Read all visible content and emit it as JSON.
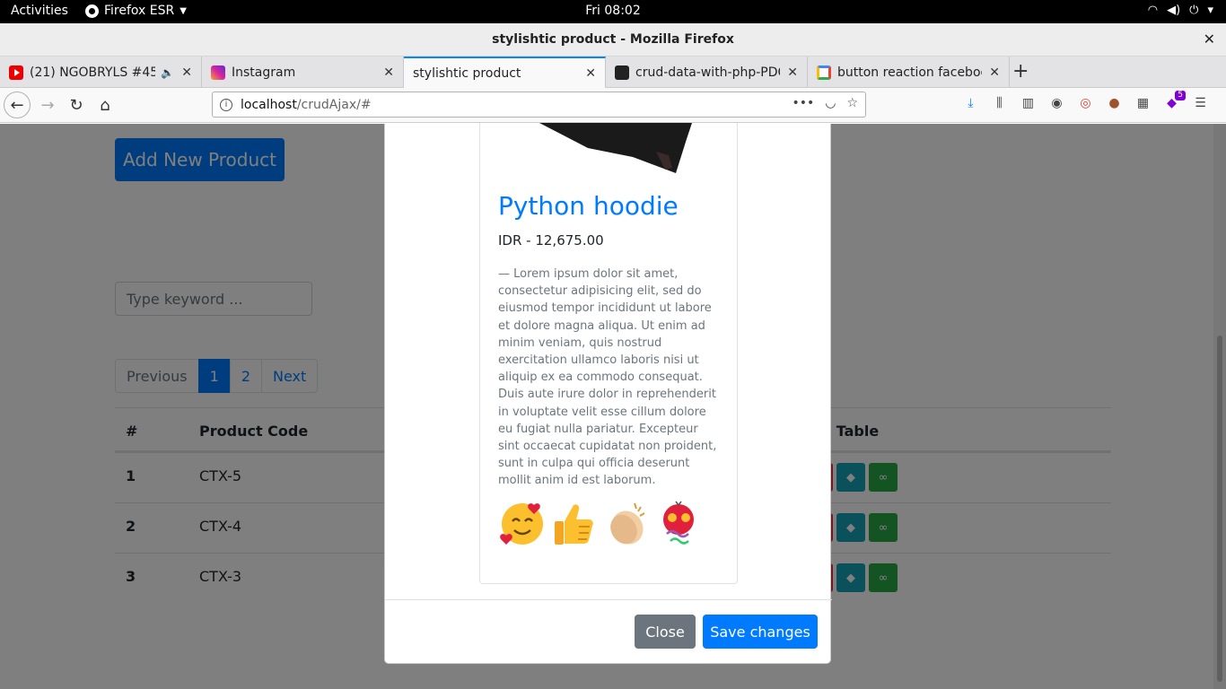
{
  "system": {
    "activities": "Activities",
    "app_name": "Firefox ESR",
    "clock": "Fri 08:02"
  },
  "window": {
    "title": "stylishtic product - Mozilla Firefox"
  },
  "tabs": [
    {
      "label": "(21) NGOBRYLS #45 |",
      "icon": "youtube-icon",
      "audio": true
    },
    {
      "label": "Instagram",
      "icon": "instagram-icon"
    },
    {
      "label": "stylishtic product",
      "icon": "",
      "active": true
    },
    {
      "label": "crud-data-with-php-PDO-",
      "icon": "github-icon"
    },
    {
      "label": "button reaction facebook",
      "icon": "google-icon"
    }
  ],
  "navbar": {
    "url_host": "localhost",
    "url_path": "/crudAjax/#",
    "extensions_badge": "5"
  },
  "page": {
    "add_button": "Add New Product",
    "search_placeholder": "Type keyword ...",
    "pagination": {
      "previous": "Previous",
      "pages": [
        "1",
        "2"
      ],
      "active_page": "1",
      "next": "Next"
    },
    "table": {
      "headers": [
        "#",
        "Product Code",
        "ration Table"
      ],
      "rows": [
        {
          "num": "1",
          "code": "CTX-5"
        },
        {
          "num": "2",
          "code": "CTX-4"
        },
        {
          "num": "3",
          "code": "CTX-3"
        }
      ]
    }
  },
  "modal": {
    "product_title": "Python hoodie",
    "price": "IDR - 12,675.00",
    "description": "—  Lorem ipsum dolor sit amet, consectetur adipisicing elit, sed do eiusmod tempor incididunt ut labore et dolore magna aliqua. Ut enim ad minim veniam, quis nostrud exercitation ullamco laboris nisi ut aliquip ex ea commodo consequat. Duis aute irure dolor in reprehenderit in voluptate velit esse cillum dolore eu fugiat nulla pariatur. Excepteur sint occaecat cupidatat non proident, sunt in culpa qui officia deserunt mollit anim id est laborum.",
    "reactions": [
      "love-face",
      "thumbs-up",
      "clapping-hands",
      "party-popper"
    ],
    "close_button": "Close",
    "save_button": "Save changes"
  },
  "colors": {
    "primary": "#007bff",
    "secondary": "#6c757d",
    "danger": "#dc3545",
    "info": "#17a2b8",
    "success": "#28a745"
  }
}
